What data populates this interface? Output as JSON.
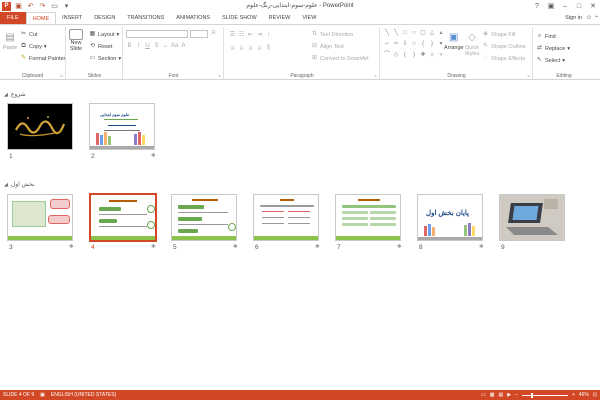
{
  "window": {
    "title": "علوم-سوم-ابتدایی-رنگ-علوم - PowerPoint",
    "sign_in": "Sign in"
  },
  "tabs": [
    "FILE",
    "HOME",
    "INSERT",
    "DESIGN",
    "TRANSITIONS",
    "ANIMATIONS",
    "SLIDE SHOW",
    "REVIEW",
    "VIEW"
  ],
  "active_tab": "HOME",
  "ribbon": {
    "clipboard": {
      "label": "Clipboard",
      "paste": "Paste",
      "cut": "Cut",
      "copy": "Copy",
      "format_painter": "Format Painter"
    },
    "slides": {
      "label": "Slides",
      "new_slide": "New",
      "new_slide2": "Slide",
      "layout": "Layout",
      "reset": "Reset",
      "section": "Section"
    },
    "font": {
      "label": "Font"
    },
    "paragraph": {
      "label": "Paragraph",
      "text_direction": "Text Direction",
      "align_text": "Align Text",
      "convert_smartart": "Convert to SmartArt"
    },
    "drawing": {
      "label": "Drawing",
      "arrange": "Arrange",
      "quick_styles": "Quick",
      "quick_styles2": "Styles",
      "shape_fill": "Shape Fill",
      "shape_outline": "Shape Outline",
      "shape_effects": "Shape Effects"
    },
    "editing": {
      "label": "Editing",
      "find": "Find",
      "replace": "Replace",
      "select": "Select"
    }
  },
  "sections": [
    {
      "name": "شروع",
      "slides": [
        "1",
        "2"
      ]
    },
    {
      "name": "بخش اول",
      "slides": [
        "3",
        "4",
        "5",
        "6",
        "7",
        "8",
        "9"
      ]
    }
  ],
  "slide_text": {
    "s2_title": "علوم سوم ابتدایی",
    "s8_title": "پایان بخش اول"
  },
  "status": {
    "slide_of": "SLIDE 4 OF 9",
    "language": "ENGLISH (UNITED STATES)",
    "zoom": "46%",
    "zoom_fraction": 0.46
  },
  "colors": {
    "accent": "#d24726",
    "green": "#8bc34a"
  }
}
